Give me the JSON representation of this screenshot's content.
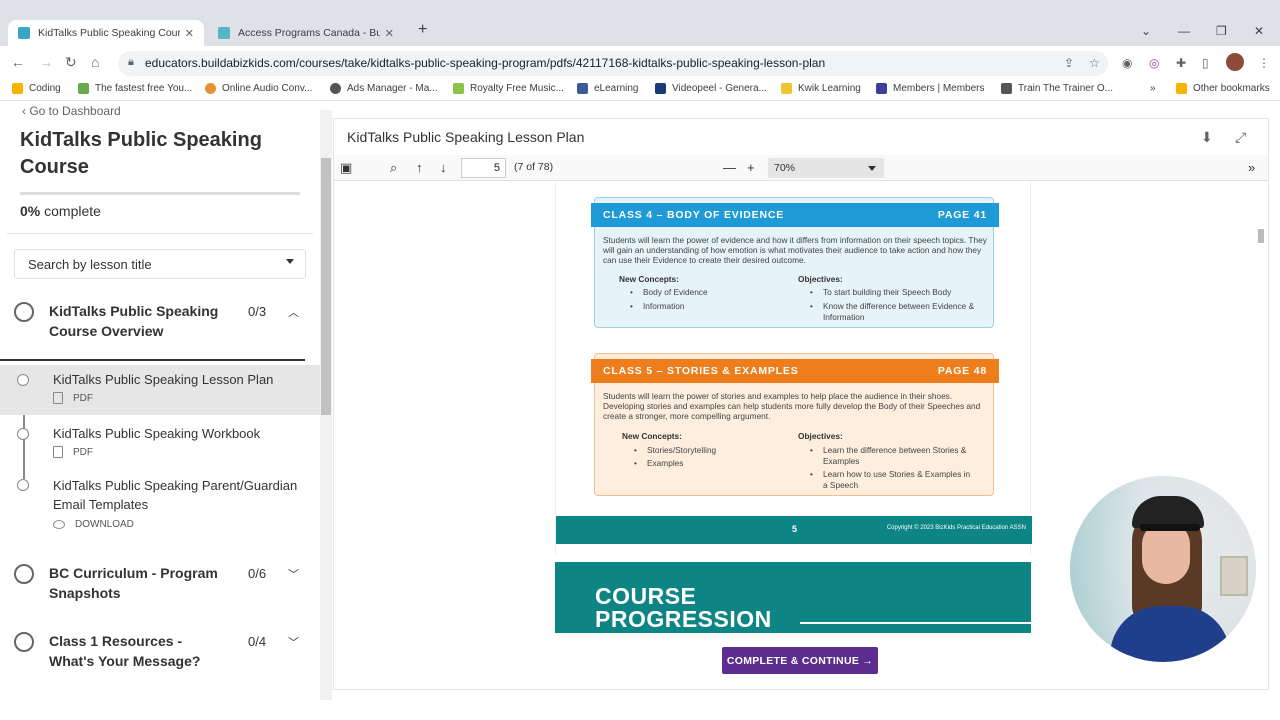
{
  "browser": {
    "tabs": [
      {
        "title": "KidTalks Public Speaking Course",
        "active": true
      },
      {
        "title": "Access Programs Canada - Build",
        "active": false
      }
    ],
    "url": "educators.buildabizkids.com/courses/take/kidtalks-public-speaking-program/pdfs/42117168-kidtalks-public-speaking-lesson-plan",
    "bookmarks": [
      "Coding",
      "The fastest free You...",
      "Online Audio Conv...",
      "Ads Manager - Ma...",
      "Royalty Free Music...",
      "eLearning",
      "Videopeel - Genera...",
      "Kwik Learning",
      "Members | Members",
      "Train The Trainer O...",
      "Other bookmarks"
    ]
  },
  "sidebar": {
    "back_label": "Go to Dashboard",
    "course_title": "KidTalks Public Speaking Course",
    "progress_pct": "0%",
    "progress_suffix": "complete",
    "progress_value": 0,
    "search_placeholder": "Search by lesson title",
    "chapters": [
      {
        "title": "KidTalks Public Speaking Course Overview",
        "count": "0/3",
        "expanded": true
      },
      {
        "title": "BC Curriculum - Program Snapshots",
        "count": "0/6",
        "expanded": false
      },
      {
        "title": "Class 1 Resources - What's Your Message?",
        "count": "0/4",
        "expanded": false
      }
    ],
    "lessons": [
      {
        "title": "KidTalks Public Speaking Lesson Plan",
        "type": "PDF",
        "active": true
      },
      {
        "title": "KidTalks Public Speaking Workbook",
        "type": "PDF",
        "active": false
      },
      {
        "title": "KidTalks Public Speaking Parent/Guardian Email Templates",
        "type": "DOWNLOAD",
        "active": false
      }
    ]
  },
  "main": {
    "doc_title": "KidTalks Public Speaking Lesson Plan",
    "pdf": {
      "page_input": "5",
      "page_count": "(7 of 78)",
      "zoom": "70%",
      "cards": [
        {
          "header": "CLASS 4 – BODY OF EVIDENCE",
          "page": "PAGE 41",
          "color": "#1e9ad6",
          "description": "Students will learn the power of evidence and how it differs from information on their speech topics. They will gain an understanding of how emotion is what motivates their audience to take action and how they can use their Evidence to create their desired outcome.",
          "concepts_label": "New Concepts:",
          "concepts": [
            "Body of Evidence",
            "Information"
          ],
          "objectives_label": "Objectives:",
          "objectives": [
            "To start building their Speech Body",
            "Know the difference between Evidence & Information"
          ]
        },
        {
          "header": "CLASS 5 – STORIES & EXAMPLES",
          "page": "PAGE 48",
          "color": "#ee7d1c",
          "description": "Students will learn the power of stories and examples to help place the audience in their shoes. Developing stories and examples can help students more fully develop the Body of their Speeches and create a stronger, more compelling argument.",
          "concepts_label": "New Concepts:",
          "concepts": [
            "Stories/Storytelling",
            "Examples"
          ],
          "objectives_label": "Objectives:",
          "objectives": [
            "Learn the difference between Stories & Examples",
            "Learn how to use Stories & Examples in a Speech"
          ]
        }
      ],
      "footer_page": "5",
      "footer_copyright": "Copyright © 2023 BizKids Practical Education ASSN",
      "next_page_heading_1": "COURSE",
      "next_page_heading_2": "PROGRESSION"
    },
    "continue_label": "COMPLETE & CONTINUE →"
  }
}
